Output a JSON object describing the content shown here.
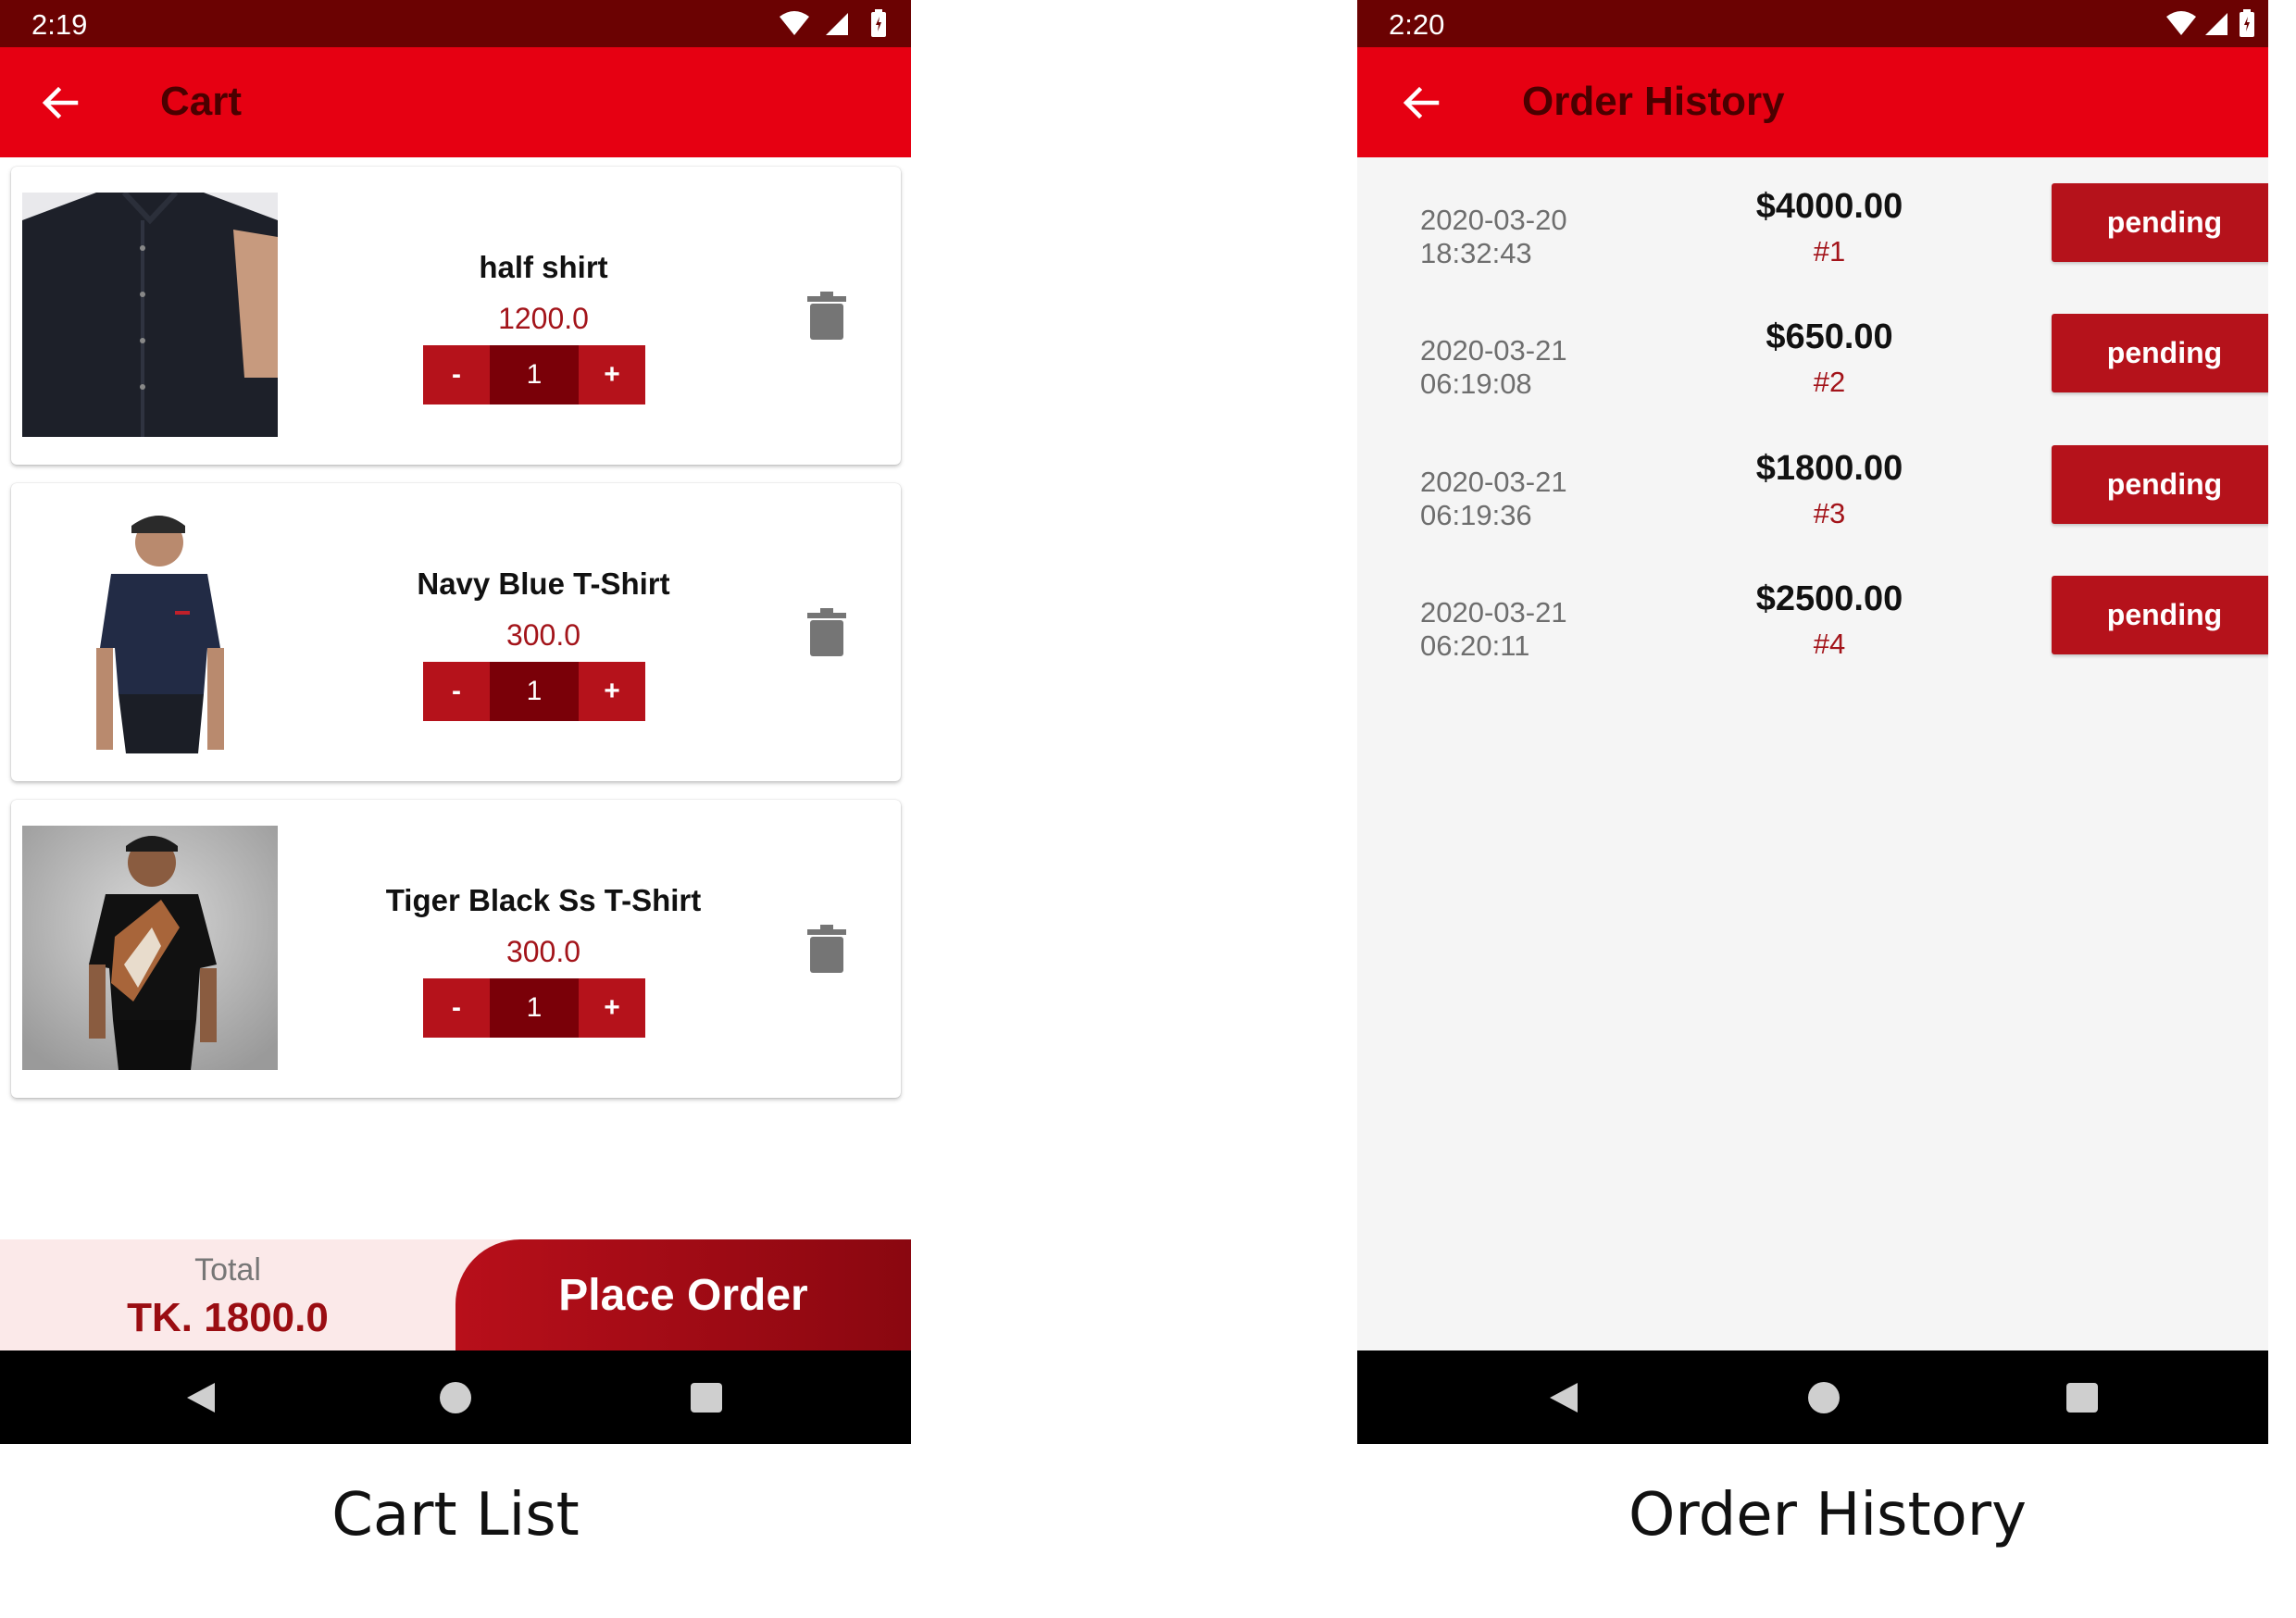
{
  "cart": {
    "status_time": "2:19",
    "title": "Cart",
    "items": [
      {
        "name": "half shirt",
        "price": "1200.0",
        "qty": "1"
      },
      {
        "name": "Navy Blue T-Shirt",
        "price": "300.0",
        "qty": "1"
      },
      {
        "name": "Tiger Black Ss T-Shirt",
        "price": "300.0",
        "qty": "1"
      }
    ],
    "minus_label": "-",
    "plus_label": "+",
    "total_label": "Total",
    "total_value": "TK. 1800.0",
    "place_order_label": "Place Order",
    "caption": "Cart List"
  },
  "history": {
    "status_time": "2:20",
    "title": "Order History",
    "orders": [
      {
        "date": "2020-03-20",
        "time": "18:32:43",
        "amount": "$4000.00",
        "number": "#1",
        "status": "pending"
      },
      {
        "date": "2020-03-21",
        "time": "06:19:08",
        "amount": "$650.00",
        "number": "#2",
        "status": "pending"
      },
      {
        "date": "2020-03-21",
        "time": "06:19:36",
        "amount": "$1800.00",
        "number": "#3",
        "status": "pending"
      },
      {
        "date": "2020-03-21",
        "time": "06:20:11",
        "amount": "$2500.00",
        "number": "#4",
        "status": "pending"
      }
    ],
    "caption": "Order History"
  },
  "colors": {
    "status_bar": "#6b0202",
    "app_bar": "#e60012",
    "accent": "#b5121b",
    "price": "#a3141a"
  },
  "icons": [
    "back-arrow-icon",
    "wifi-icon",
    "signal-icon",
    "battery-icon",
    "trash-icon",
    "shirt-image",
    "nav-back-icon",
    "nav-home-icon",
    "nav-recent-icon"
  ]
}
